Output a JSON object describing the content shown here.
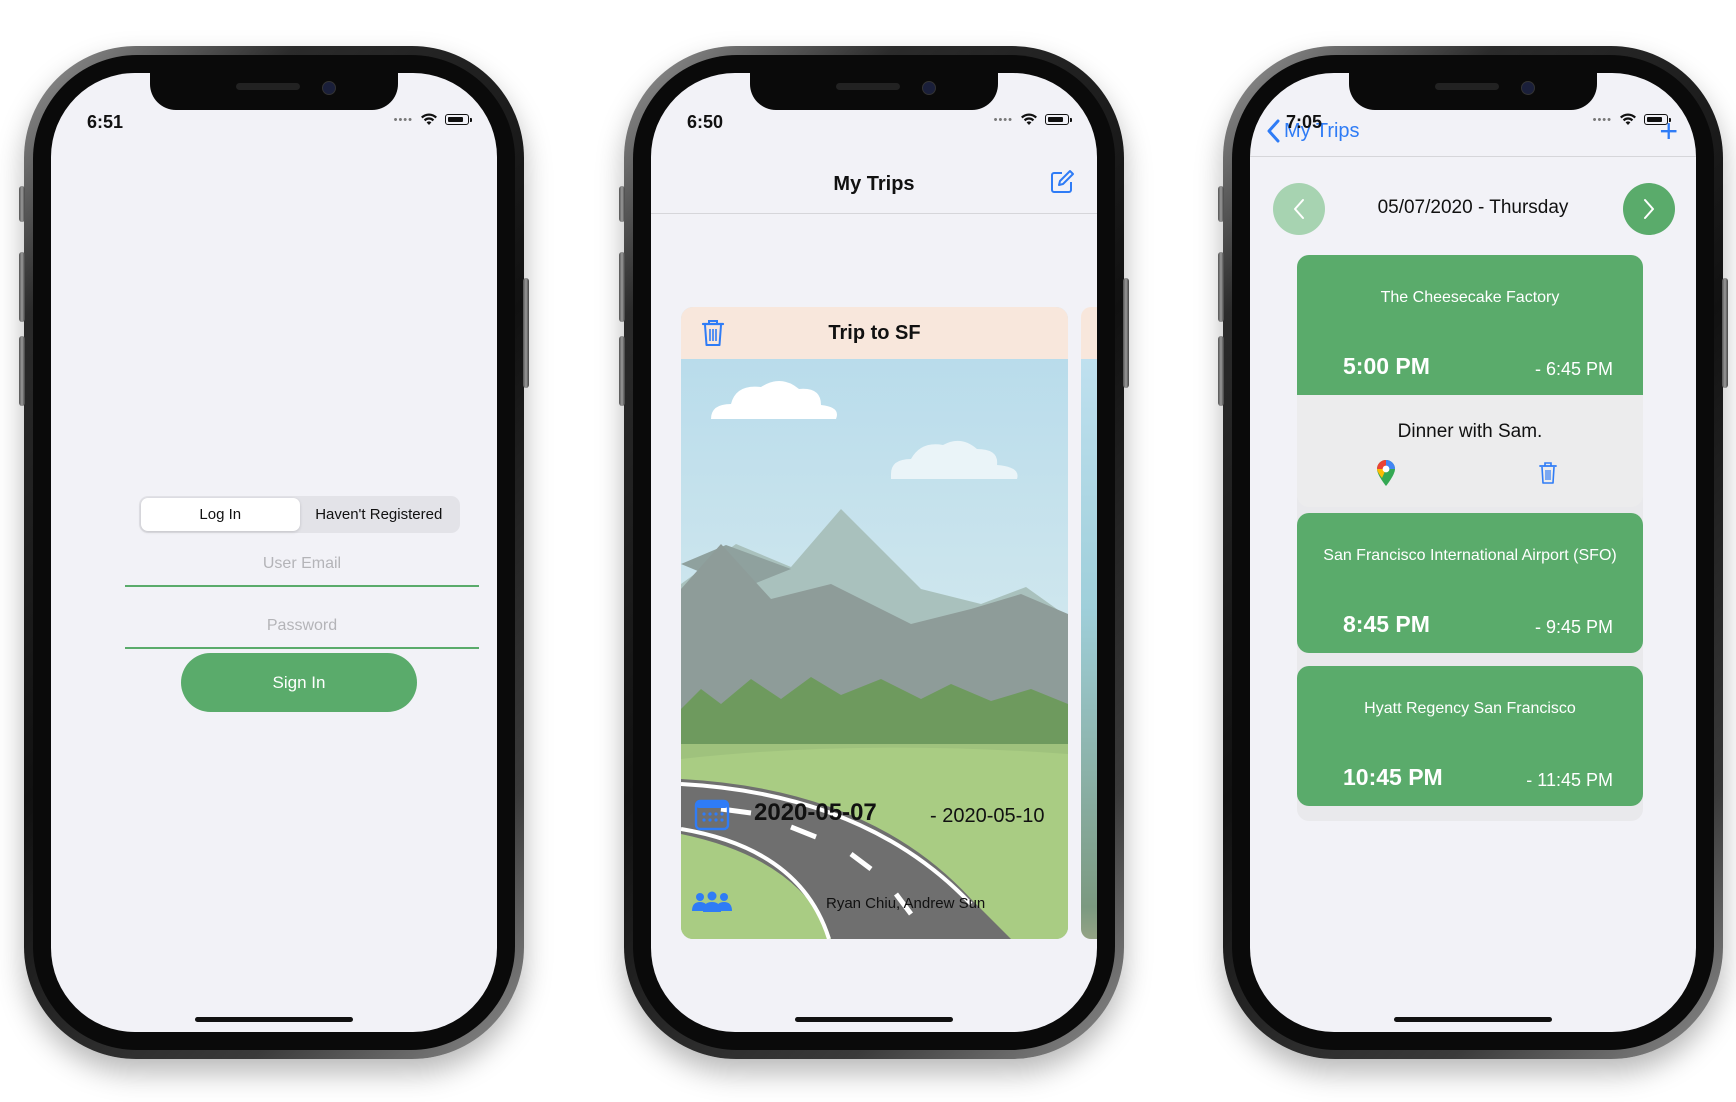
{
  "login_screen": {
    "time": "6:51",
    "tabs": [
      "Log In",
      "Haven't Registered"
    ],
    "email_placeholder": "User Email",
    "password_placeholder": "Password",
    "sign_in_label": "Sign In"
  },
  "trips_screen": {
    "time": "6:50",
    "title": "My Trips",
    "trip": {
      "name": "Trip to SF",
      "start_date": "2020-05-07",
      "end_date": "- 2020-05-10",
      "members": "Ryan Chiu, Andrew Sun"
    }
  },
  "itinerary_screen": {
    "time": "7:05",
    "back_label": "My Trips",
    "add_label": "+",
    "day_label": "05/07/2020 - Thursday",
    "events": [
      {
        "place": "The Cheesecake Factory",
        "start": "5:00 PM",
        "end": "- 6:45 PM",
        "note": "Dinner with Sam."
      },
      {
        "place": "San Francisco International Airport (SFO)",
        "start": "8:45 PM",
        "end": "- 9:45 PM"
      },
      {
        "place": "Hyatt Regency San Francisco",
        "start": "10:45 PM",
        "end": "- 11:45 PM"
      }
    ]
  },
  "colors": {
    "accent_green": "#5aab6b",
    "link_blue": "#2f7cf6",
    "background": "#f2f2f7",
    "card_header": "#f8e7dc"
  }
}
